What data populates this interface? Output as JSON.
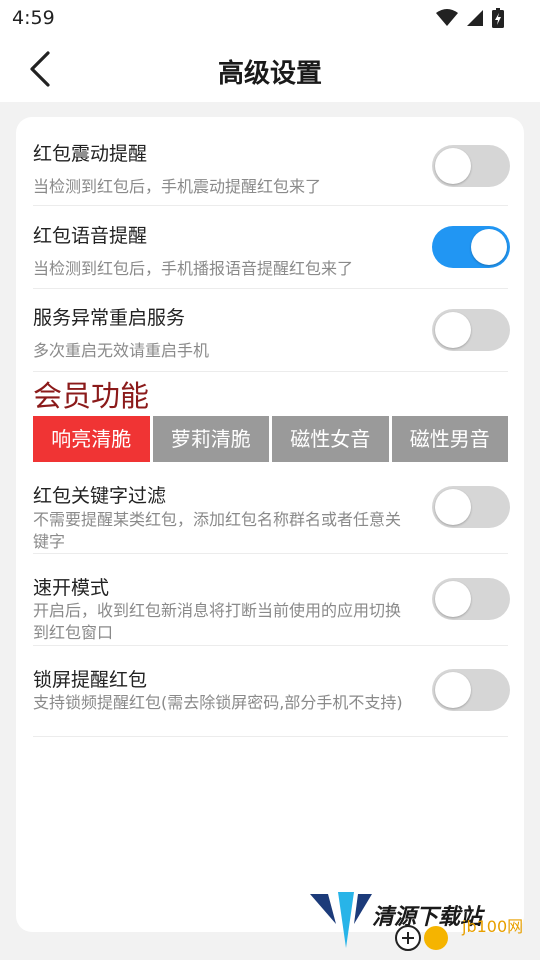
{
  "status": {
    "time": "4:59"
  },
  "header": {
    "title": "高级设置"
  },
  "settings": [
    {
      "title": "红包震动提醒",
      "desc": "当检测到红包后，手机震动提醒红包来了",
      "on": false
    },
    {
      "title": "红包语音提醒",
      "desc": "当检测到红包后，手机播报语音提醒红包来了",
      "on": true
    },
    {
      "title": "服务异常重启服务",
      "desc": "多次重启无效请重启手机",
      "on": false
    },
    {
      "title": "红包关键字过滤",
      "desc": "不需要提醒某类红包，添加红包名称群名或者任意关键字",
      "on": false
    },
    {
      "title": "速开模式",
      "desc": "开启后，收到红包新消息将打断当前使用的应用切换到红包窗口",
      "on": false
    },
    {
      "title": "锁屏提醒红包",
      "desc": "支持锁频提醒红包(需去除锁屏密码,部分手机不支持)",
      "on": false
    }
  ],
  "member": {
    "title": "会员功能",
    "voices": [
      "响亮清脆",
      "萝莉清脆",
      "磁性女音",
      "磁性男音"
    ],
    "selected_index": 0
  },
  "watermark": {
    "brand": "清源下载站",
    "site": "jb100网"
  },
  "colors": {
    "accent": "#2196f3",
    "active_tab": "#f03434",
    "section_title": "#8b1a1a"
  }
}
